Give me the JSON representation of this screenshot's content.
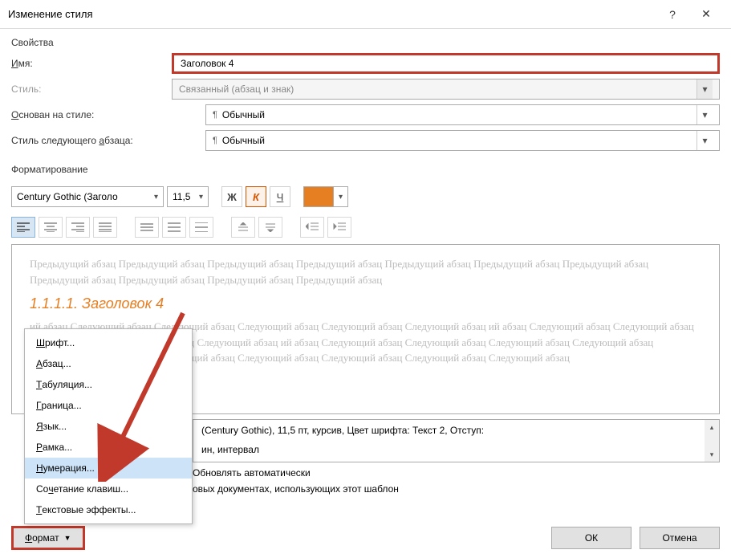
{
  "titlebar": {
    "title": "Изменение стиля"
  },
  "section_props": "Свойства",
  "fields": {
    "name_label": "Имя:",
    "name_u": "И",
    "name_value": "Заголовок 4",
    "style_label": "Стиль:",
    "style_value": "Связанный (абзац и знак)",
    "based_label": "снован на стиле:",
    "based_u": "О",
    "based_value": "Обычный",
    "next_label": "Стиль следующего ",
    "next_label2": "бзаца:",
    "next_u": "а",
    "next_value": "Обычный"
  },
  "section_format": "Форматирование",
  "toolbar": {
    "font": "Century Gothic (Заголо",
    "size": "11,5",
    "bold": "Ж",
    "italic": "К",
    "underline": "Ч",
    "color": "#e67e22"
  },
  "preview": {
    "prev_para": "Предыдущий абзац Предыдущий абзац Предыдущий абзац Предыдущий абзац Предыдущий абзац Предыдущий абзац Предыдущий абзац Предыдущий абзац Предыдущий абзац Предыдущий абзац Предыдущий абзац",
    "heading": "1.1.1.1. Заголовок 4",
    "next_para": "ий абзац Следующий абзац Следующий абзац Следующий абзац Следующий абзац Следующий абзац ий абзац Следующий абзац Следующий абзац Следующий абзац Следующий абзац Следующий абзац ий абзац Следующий абзац Следующий абзац Следующий абзац Следующий абзац Следующий абзац ий абзац Следующий абзац Следующий абзац Следующий абзац Следующий абзац Следующий абзац"
  },
  "desc": {
    "line1": "(Century Gothic), 11,5 пт, курсив, Цвет шрифта: Текст 2, Отступ:",
    "line2": "ин, интервал"
  },
  "checks": {
    "auto_update": "Обновлять автоматически",
    "templates": "овых документах, использующих этот шаблон"
  },
  "menu": {
    "font_u": "Ш",
    "font": "рифт...",
    "para_u": "А",
    "para": "бзац...",
    "tab_u": "Т",
    "tab": "абуляция...",
    "border_u": "Г",
    "border": "раница...",
    "lang_u": "Я",
    "lang": "зык...",
    "frame_u": "Р",
    "frame": "амка...",
    "num_u": "Н",
    "num": "умерация...",
    "shortcut": "Со",
    "shortcut_u": "ч",
    "shortcut2": "етание клавиш...",
    "effects_u": "Т",
    "effects": "екстовые эффекты..."
  },
  "footer": {
    "format_u": "Ф",
    "format": "ормат",
    "ok": "ОК",
    "cancel": "Отмена"
  }
}
